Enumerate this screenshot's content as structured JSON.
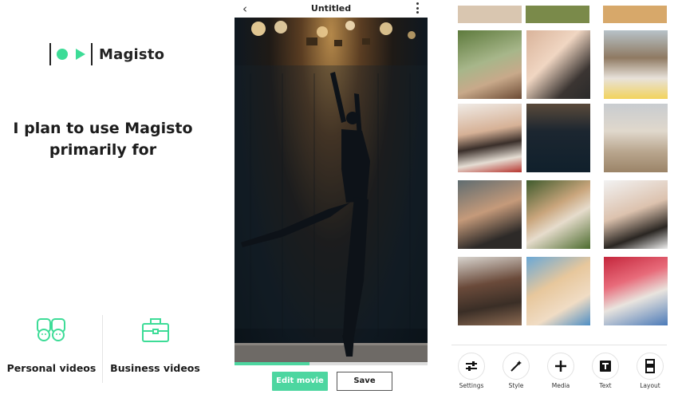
{
  "onboarding": {
    "brand": "Magisto",
    "headline_line1": "I plan to use Magisto",
    "headline_line2": "primarily for",
    "options": [
      {
        "label": "Personal videos",
        "icon": "people-icon"
      },
      {
        "label": "Business videos",
        "icon": "briefcase-icon"
      }
    ],
    "accent": "#3ddc97"
  },
  "editor": {
    "title": "Untitled",
    "progress": 0.39,
    "edit_label": "Edit movie",
    "save_label": "Save",
    "accent": "#4dd6a0"
  },
  "gallery": {
    "toolbar": [
      {
        "label": "Settings",
        "icon": "settings-sliders-icon"
      },
      {
        "label": "Style",
        "icon": "magic-wand-icon"
      },
      {
        "label": "Media",
        "icon": "plus-icon"
      },
      {
        "label": "Text",
        "icon": "text-t-icon"
      },
      {
        "label": "Layout",
        "icon": "layout-icon"
      }
    ]
  }
}
